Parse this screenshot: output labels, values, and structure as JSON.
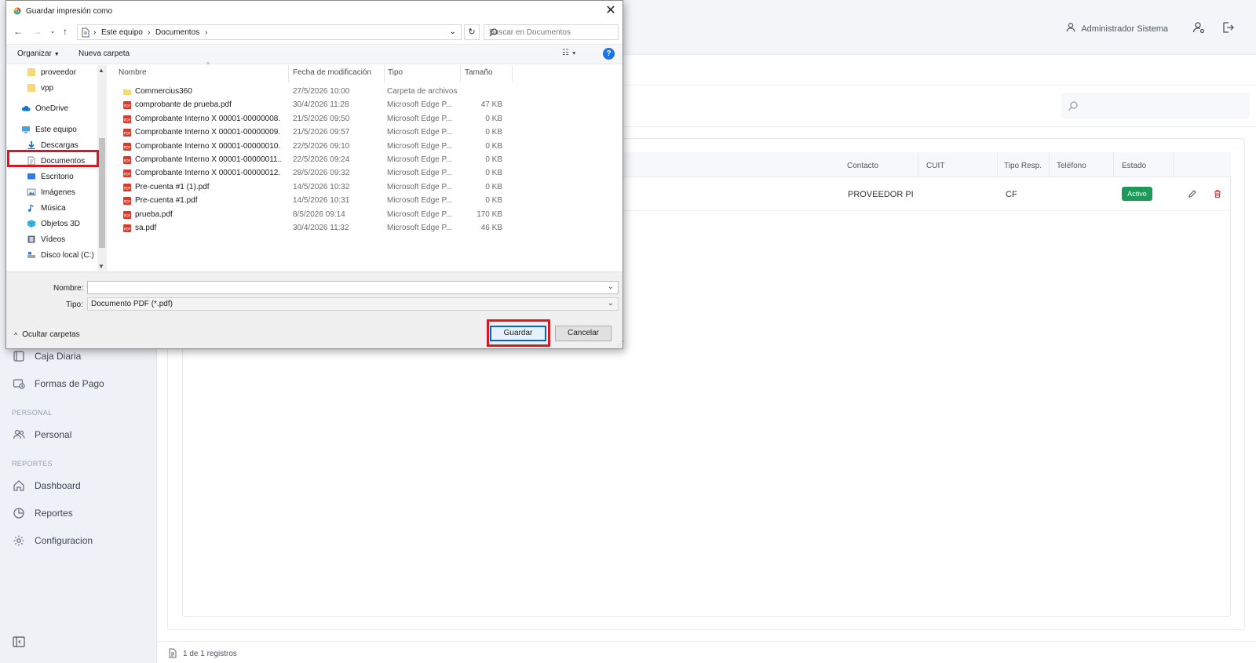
{
  "app": {
    "user_name": "Administrador Sistema",
    "sidebar": {
      "items": [
        {
          "label": "Caja Diaria",
          "icon": "cash-register-icon"
        },
        {
          "label": "Formas de Pago",
          "icon": "payment-icon"
        },
        {
          "label": "Personal",
          "icon": "users-icon"
        },
        {
          "label": "Dashboard",
          "icon": "home-icon"
        },
        {
          "label": "Reportes",
          "icon": "reports-icon"
        },
        {
          "label": "Configuracion",
          "icon": "gear-icon"
        }
      ],
      "sections": [
        "PERSONAL",
        "REPORTES"
      ]
    },
    "table": {
      "headers": [
        "Contacto",
        "CUIT",
        "Tipo Resp.",
        "Teléfono",
        "Estado"
      ],
      "row": {
        "contacto": "PROVEEDOR PI",
        "cuit": "",
        "tipo_resp": "CF",
        "telefono": "",
        "estado": "Activo"
      }
    },
    "footer": {
      "records": "1 de 1 registros"
    },
    "colors": {
      "active_badge": "#1d9a5a",
      "delete_icon": "#d93636",
      "highlight": "#d71921"
    }
  },
  "dialog": {
    "title": "Guardar impresión como",
    "address": {
      "crumbs": [
        "Este equipo",
        "Documentos"
      ]
    },
    "search_placeholder": "Buscar en Documentos",
    "toolbar": {
      "organize": "Organizar",
      "new_folder": "Nueva carpeta",
      "help": "?"
    },
    "nav_pane": [
      {
        "label": "proveedor",
        "icon": "folder-icon"
      },
      {
        "label": "vpp",
        "icon": "folder-icon"
      },
      {
        "label": "OneDrive",
        "icon": "cloud-icon"
      },
      {
        "label": "Este equipo",
        "icon": "computer-icon"
      },
      {
        "label": "Descargas",
        "icon": "download-icon"
      },
      {
        "label": "Documentos",
        "icon": "documents-icon"
      },
      {
        "label": "Escritorio",
        "icon": "desktop-icon"
      },
      {
        "label": "Imágenes",
        "icon": "images-icon"
      },
      {
        "label": "Música",
        "icon": "music-icon"
      },
      {
        "label": "Objetos 3D",
        "icon": "cube-icon"
      },
      {
        "label": "Vídeos",
        "icon": "video-icon"
      },
      {
        "label": "Disco local (C:)",
        "icon": "drive-icon"
      }
    ],
    "columns": [
      "Nombre",
      "Fecha de modificación",
      "Tipo",
      "Tamaño"
    ],
    "files": [
      {
        "name": "Commercius360",
        "date": "27/5/2026 10:00",
        "type": "Carpeta de archivos",
        "size": "",
        "icon": "folder"
      },
      {
        "name": "comprobante de prueba.pdf",
        "date": "30/4/2026 11:28",
        "type": "Microsoft Edge P...",
        "size": "47 KB",
        "icon": "pdf"
      },
      {
        "name": "Comprobante Interno X 00001-00000008....",
        "date": "21/5/2026 09:50",
        "type": "Microsoft Edge P...",
        "size": "0 KB",
        "icon": "pdf"
      },
      {
        "name": "Comprobante Interno X 00001-00000009....",
        "date": "21/5/2026 09:57",
        "type": "Microsoft Edge P...",
        "size": "0 KB",
        "icon": "pdf"
      },
      {
        "name": "Comprobante Interno X 00001-00000010....",
        "date": "22/5/2026 09:10",
        "type": "Microsoft Edge P...",
        "size": "0 KB",
        "icon": "pdf"
      },
      {
        "name": "Comprobante Interno X 00001-00000011....",
        "date": "22/5/2026 09:24",
        "type": "Microsoft Edge P...",
        "size": "0 KB",
        "icon": "pdf"
      },
      {
        "name": "Comprobante Interno X 00001-00000012....",
        "date": "28/5/2026 09:32",
        "type": "Microsoft Edge P...",
        "size": "0 KB",
        "icon": "pdf"
      },
      {
        "name": "Pre-cuenta #1 (1).pdf",
        "date": "14/5/2026 10:32",
        "type": "Microsoft Edge P...",
        "size": "0 KB",
        "icon": "pdf"
      },
      {
        "name": "Pre-cuenta #1.pdf",
        "date": "14/5/2026 10:31",
        "type": "Microsoft Edge P...",
        "size": "0 KB",
        "icon": "pdf"
      },
      {
        "name": "prueba.pdf",
        "date": "8/5/2026 09:14",
        "type": "Microsoft Edge P...",
        "size": "170 KB",
        "icon": "pdf"
      },
      {
        "name": "sa.pdf",
        "date": "30/4/2026 11:32",
        "type": "Microsoft Edge P...",
        "size": "46 KB",
        "icon": "pdf"
      }
    ],
    "form": {
      "name_label": "Nombre:",
      "name_value": "",
      "type_label": "Tipo:",
      "type_value": "Documento PDF (*.pdf)"
    },
    "hide_folders": "Ocultar carpetas",
    "save_button": "Guardar",
    "cancel_button": "Cancelar"
  }
}
